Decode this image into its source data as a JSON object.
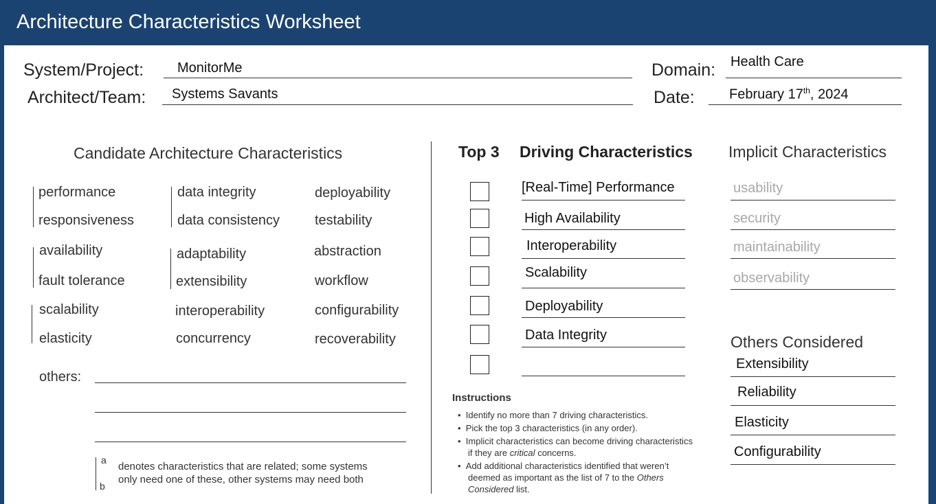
{
  "header": {
    "title": "Architecture Characteristics Worksheet"
  },
  "info": {
    "system_label": "System/Project:",
    "system_value": "MonitorMe",
    "architect_label": "Architect/Team:",
    "architect_value": "Systems Savants",
    "domain_label": "Domain:",
    "domain_value": "Health Care",
    "date_label": "Date:",
    "date_value_prefix": "February 17",
    "date_value_sup": "th",
    "date_value_suffix": ", 2024"
  },
  "candidates": {
    "heading": "Candidate Architecture Characteristics",
    "col1": [
      "performance",
      "responsiveness",
      "availability",
      "fault tolerance",
      "scalability",
      "elasticity"
    ],
    "col2": [
      "data integrity",
      "data consistency",
      "adaptability",
      "extensibility",
      "interoperability",
      "concurrency"
    ],
    "col3": [
      "deployability",
      "testability",
      "abstraction",
      "workflow",
      "configurability",
      "recoverability"
    ],
    "others_label": "others:",
    "note_a": "a",
    "note_b": "b",
    "note_line1": "denotes characteristics that are related; some systems",
    "note_line2": "only need one of these, other systems may need both"
  },
  "driving": {
    "top3_label": "Top 3",
    "heading": "Driving Characteristics",
    "items": [
      "[Real-Time] Performance",
      "High Availability",
      "Interoperability",
      "Scalability",
      "Deployability",
      "Data Integrity",
      ""
    ]
  },
  "implicit": {
    "heading": "Implicit Characteristics",
    "items": [
      "usability",
      "security",
      "maintainability",
      "observability"
    ]
  },
  "others_considered": {
    "heading": "Others Considered",
    "items": [
      "Extensibility",
      "Reliability",
      "Elasticity",
      "Configurability"
    ]
  },
  "instructions": {
    "title": "Instructions",
    "items": [
      "Identify no more than 7 driving characteristics.",
      "Pick the top 3 characteristics (in any order).",
      "Implicit characteristics can become driving characteristics",
      "if they are",
      "critical",
      "concerns.",
      "Add additional characteristics identified that weren’t",
      "deemed as important as the list of 7 to the",
      "Others",
      "Considered",
      "list."
    ]
  }
}
